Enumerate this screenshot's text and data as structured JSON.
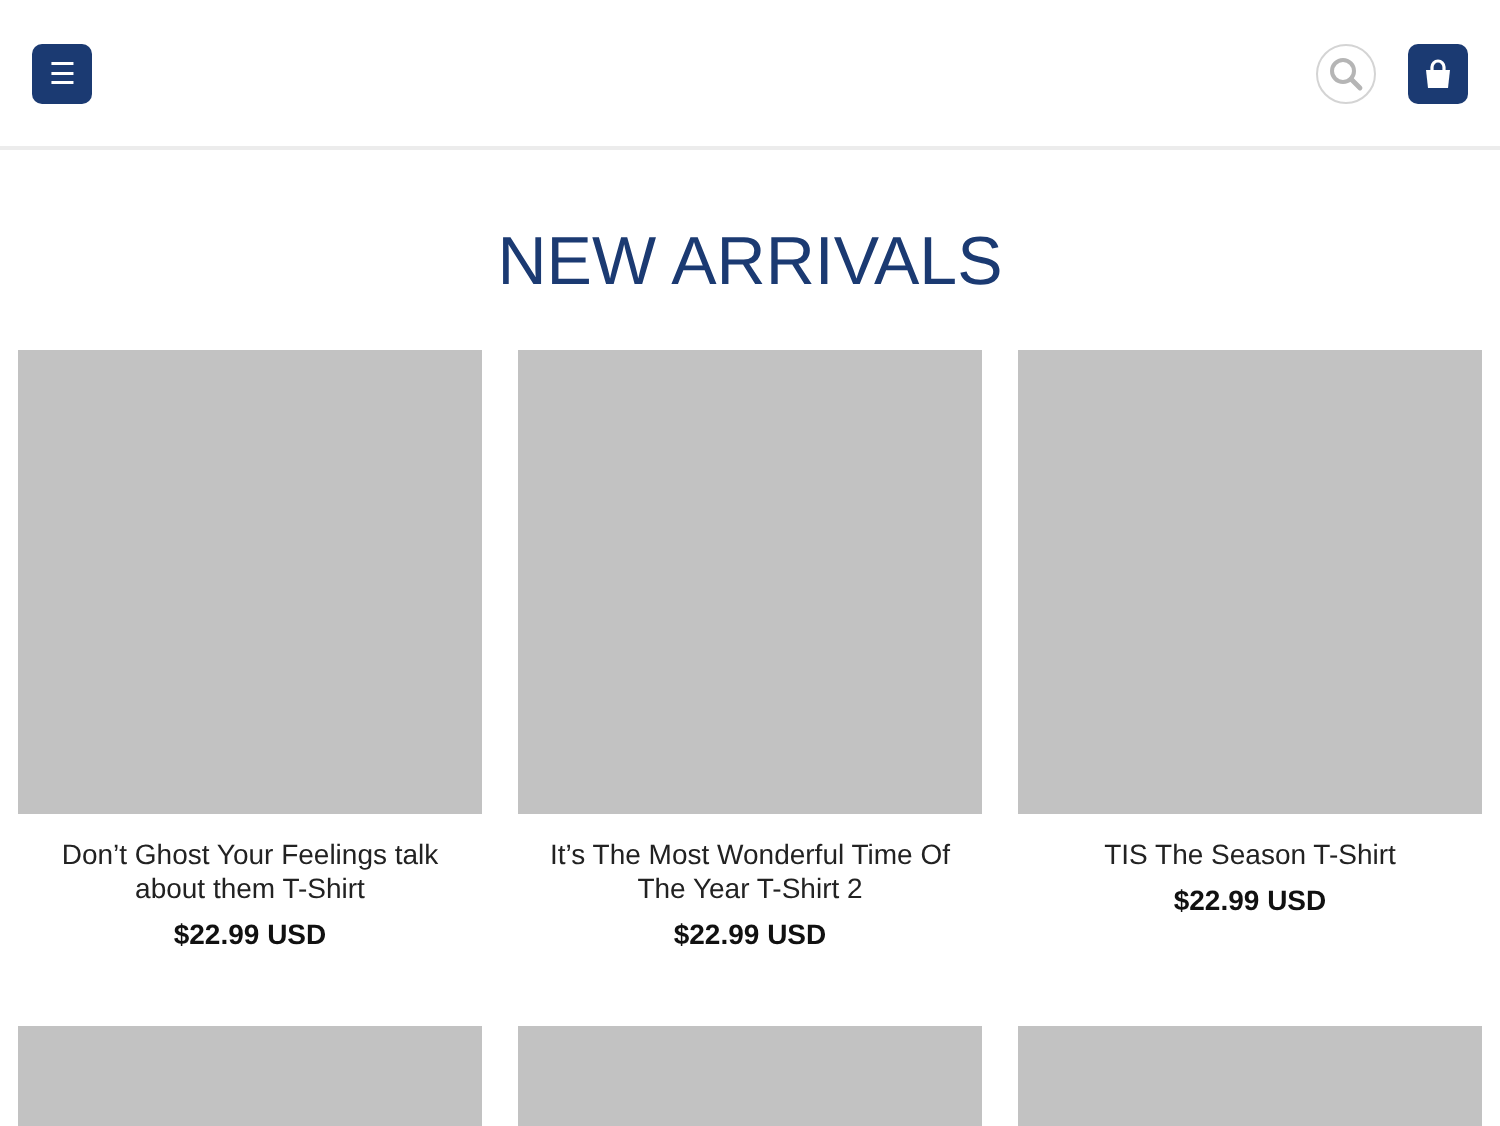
{
  "header": {
    "menu_button": "☰"
  },
  "section": {
    "title": "NEW ARRIVALS"
  },
  "products": [
    {
      "kind": "product",
      "name": "Don’t Ghost Your Feelings talk about them T-Shirt",
      "price": "$22.99 USD"
    },
    {
      "kind": "product",
      "name": "It’s The Most Wonderful Time Of The Year T-Shirt 2",
      "price": "$22.99 USD"
    },
    {
      "kind": "product",
      "name": "TIS The Season T-Shirt",
      "price": "$22.99 USD"
    },
    {
      "kind": "image_only"
    },
    {
      "kind": "image_only"
    },
    {
      "kind": "image_only"
    }
  ]
}
